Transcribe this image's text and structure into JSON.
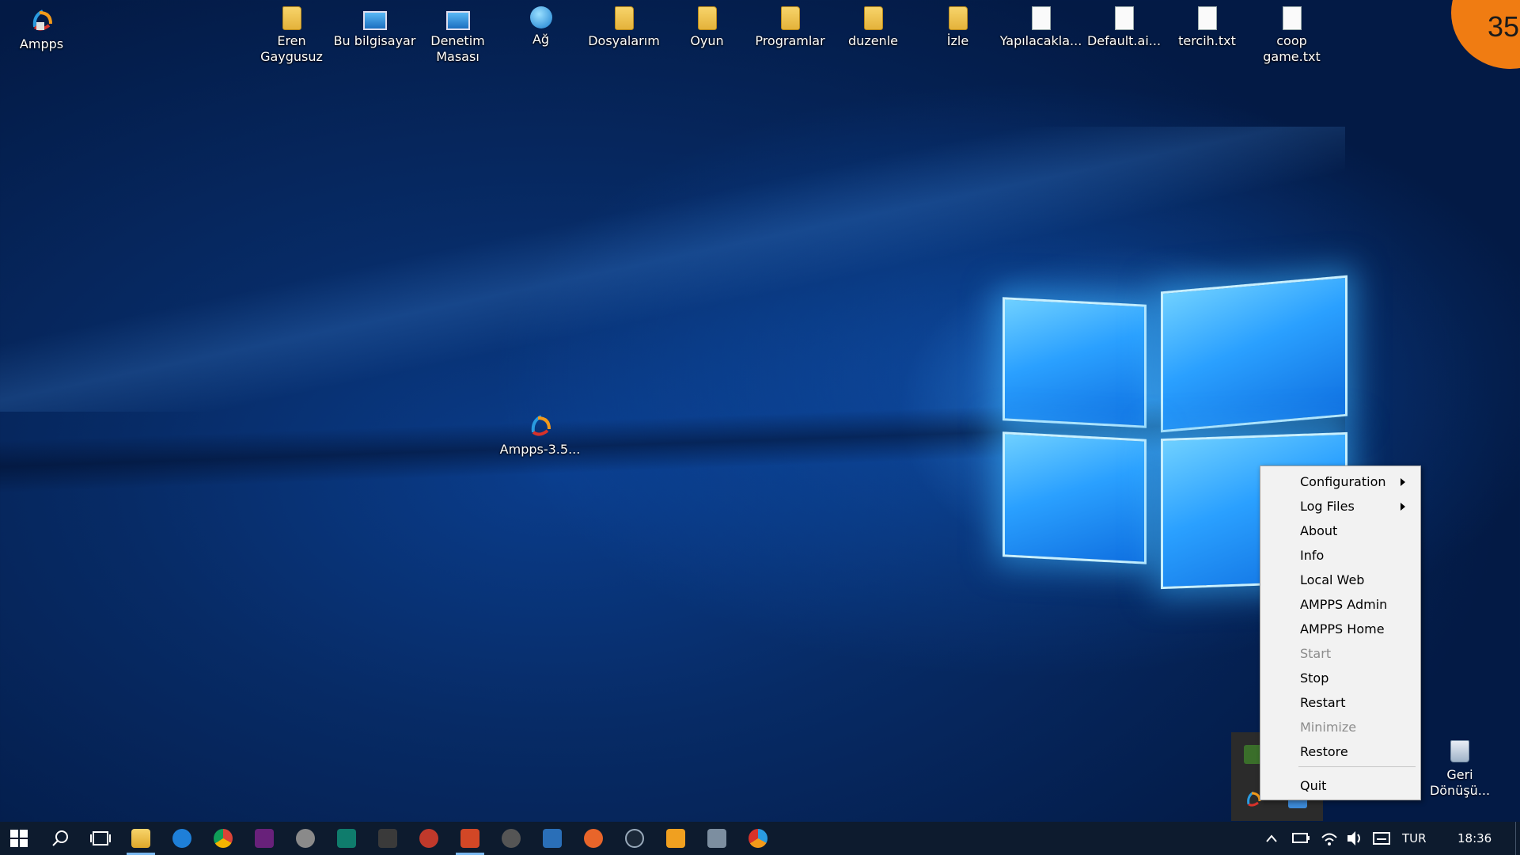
{
  "desktop": {
    "icons": [
      {
        "label": "Ampps",
        "icon": "ampps-icon"
      },
      {
        "label": "Eren Gaygusuz",
        "icon": "user-folder-icon"
      },
      {
        "label": "Bu bilgisayar",
        "icon": "this-pc-icon"
      },
      {
        "label": "Denetim Masası",
        "icon": "control-panel-icon"
      },
      {
        "label": "Ağ",
        "icon": "network-icon"
      },
      {
        "label": "Dosyalarım",
        "icon": "folder-icon"
      },
      {
        "label": "Oyun",
        "icon": "folder-icon"
      },
      {
        "label": "Programlar",
        "icon": "folder-icon"
      },
      {
        "label": "duzenle",
        "icon": "folder-icon"
      },
      {
        "label": "İzle",
        "icon": "folder-icon"
      },
      {
        "label": "Yapılacakla...",
        "icon": "text-file-icon"
      },
      {
        "label": "Default.ai...",
        "icon": "file-icon"
      },
      {
        "label": "tercih.txt",
        "icon": "text-file-icon"
      },
      {
        "label": "coop game.txt",
        "icon": "text-file-icon"
      }
    ],
    "installer_label": "Ampps-3.5...",
    "recycle_bin_label": "Geri Dönüşü...",
    "badge_number": "35"
  },
  "context_menu": {
    "items": [
      {
        "label": "Configuration",
        "submenu": true,
        "enabled": true
      },
      {
        "label": "Log Files",
        "submenu": true,
        "enabled": true
      },
      {
        "label": "About",
        "submenu": false,
        "enabled": true
      },
      {
        "label": "Info",
        "submenu": false,
        "enabled": true
      },
      {
        "label": "Local Web",
        "submenu": false,
        "enabled": true
      },
      {
        "label": "AMPPS Admin",
        "submenu": false,
        "enabled": true
      },
      {
        "label": "AMPPS Home",
        "submenu": false,
        "enabled": true
      },
      {
        "label": "Start",
        "submenu": false,
        "enabled": false
      },
      {
        "label": "Stop",
        "submenu": false,
        "enabled": true
      },
      {
        "label": "Restart",
        "submenu": false,
        "enabled": true
      },
      {
        "label": "Minimize",
        "submenu": false,
        "enabled": false
      },
      {
        "label": "Restore",
        "submenu": false,
        "enabled": true
      },
      {
        "label": "Quit",
        "submenu": false,
        "enabled": true
      }
    ]
  },
  "taskbar": {
    "apps": [
      "start-icon",
      "search-icon",
      "task-view-icon",
      "file-explorer-icon",
      "edge-icon",
      "chrome-icon",
      "visual-studio-icon",
      "settings-app-icon",
      "app-icon",
      "media-icon",
      "app-icon",
      "powerpoint-icon",
      "app-icon",
      "app-icon",
      "app-icon",
      "steam-icon",
      "app-icon",
      "box-icon",
      "ampps-icon"
    ],
    "language": "TUR",
    "time": "18:36"
  },
  "colors": {
    "taskbar_bg": "#0d1b2e",
    "menu_bg": "#f2f2f2",
    "badge": "#f07c12",
    "accent": "#7ab8f0"
  }
}
